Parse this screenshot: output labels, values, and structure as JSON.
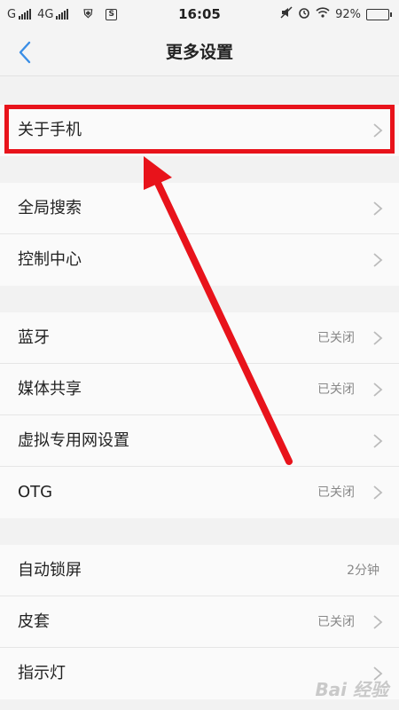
{
  "status_bar": {
    "carrier1": "G",
    "carrier2": "4G",
    "sim_badge": "S",
    "time": "16:05",
    "battery": "92%",
    "battery_level": 0.92
  },
  "header": {
    "title": "更多设置"
  },
  "groups": [
    {
      "rows": [
        {
          "label": "关于手机",
          "value": ""
        }
      ]
    },
    {
      "rows": [
        {
          "label": "全局搜索",
          "value": ""
        },
        {
          "label": "控制中心",
          "value": ""
        }
      ]
    },
    {
      "rows": [
        {
          "label": "蓝牙",
          "value": "已关闭"
        },
        {
          "label": "媒体共享",
          "value": "已关闭"
        },
        {
          "label": "虚拟专用网设置",
          "value": ""
        },
        {
          "label": "OTG",
          "value": "已关闭"
        }
      ]
    },
    {
      "rows": [
        {
          "label": "自动锁屏",
          "value": "2分钟"
        },
        {
          "label": "皮套",
          "value": "已关闭"
        },
        {
          "label": "指示灯",
          "value": ""
        }
      ]
    }
  ],
  "watermark": "Bai 经验",
  "colors": {
    "annotation": "#e8131b",
    "back_arrow": "#3a8ee6"
  }
}
